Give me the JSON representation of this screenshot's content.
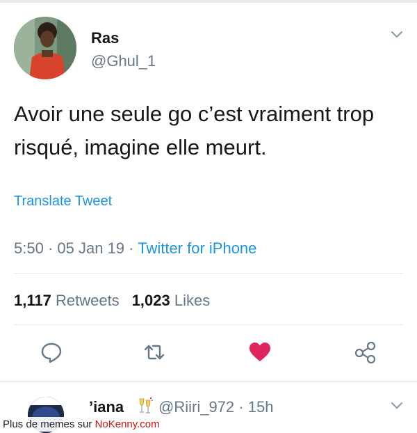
{
  "tweet": {
    "author_name": "Ras",
    "author_handle": "@Ghul_1",
    "text": "Avoir une seule go c’est vraiment trop risqué, imagine elle meurt.",
    "translate_label": "Translate Tweet",
    "time": "5:50",
    "date": "05 Jan 19",
    "meta_sep": "·",
    "source": "Twitter for iPhone",
    "retweets_count": "1,117",
    "retweets_label": "Retweets",
    "likes_count": "1,023",
    "likes_label": "Likes",
    "liked": true
  },
  "actions": [
    {
      "name": "reply",
      "icon": "reply-icon"
    },
    {
      "name": "retweet",
      "icon": "retweet-icon"
    },
    {
      "name": "like",
      "icon": "heart-icon"
    },
    {
      "name": "share",
      "icon": "share-icon"
    }
  ],
  "next_reply": {
    "author_name": "ʼiana",
    "emoji": "champagne-icon",
    "author_handle": "@Riiri_972",
    "sep": "·",
    "age": "15h"
  },
  "watermark": {
    "prefix": "Plus de memes sur ",
    "brand": "NoKenny.com"
  },
  "colors": {
    "accent": "#1b95e0",
    "like": "#e0245e",
    "secondary_text": "#657786",
    "divider": "#e6ecf0"
  }
}
